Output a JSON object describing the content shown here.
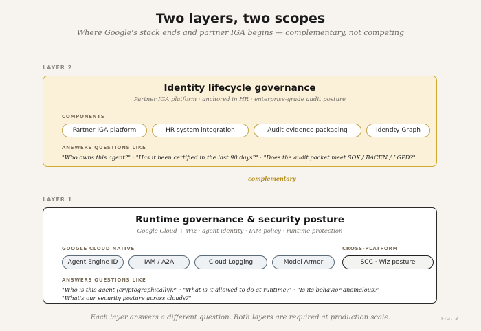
{
  "title": "Two layers, two scopes",
  "subtitle": "Where Google's stack ends and partner IGA begins — complementary, not competing",
  "layer2": {
    "label": "LAYER 2",
    "title": "Identity lifecycle governance",
    "subtitle": "Partner IGA platform · anchored in HR · enterprise-grade audit posture",
    "components_label": "COMPONENTS",
    "components": [
      "Partner IGA platform",
      "HR system integration",
      "Audit evidence packaging",
      "Identity Graph"
    ],
    "questions_label": "ANSWERS QUESTIONS LIKE",
    "questions": "\"Who owns this agent?\" · \"Has it been certified in the last 90 days?\" · \"Does the audit packet meet SOX / BACEN / LGPD?\""
  },
  "connector": {
    "label": "complementary"
  },
  "layer1": {
    "label": "LAYER 1",
    "title": "Runtime governance & security posture",
    "subtitle": "Google Cloud + Wiz · agent identity · IAM policy · runtime protection",
    "native_label": "GOOGLE CLOUD NATIVE",
    "native_components": [
      "Agent Engine ID",
      "IAM / A2A",
      "Cloud Logging",
      "Model Armor"
    ],
    "cross_label": "CROSS-PLATFORM",
    "cross_components": [
      "SCC · Wiz posture"
    ],
    "questions_label": "ANSWERS QUESTIONS LIKE",
    "questions_line1": "\"Who is this agent (cryptographically)?\" · \"What is it allowed to do at runtime?\" · \"Is its behavior anomalous?\"",
    "questions_line2": "\"What's our security posture across clouds?\""
  },
  "footer": "Each layer answers a different question. Both layers are required at production scale.",
  "fig_label": "FIG. 3",
  "colors": {
    "accent_gold": "#c9a32a",
    "layer2_fill": "#fbf1d9",
    "layer1_border": "#2a2a2a",
    "background": "#f7f4ef"
  }
}
